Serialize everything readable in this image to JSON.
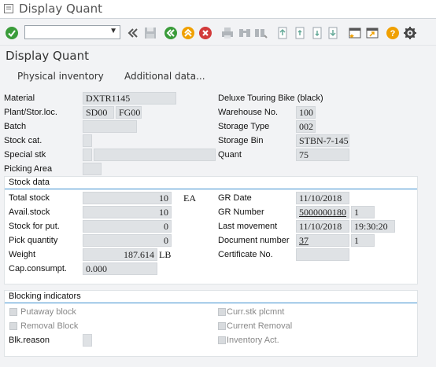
{
  "window": {
    "title": "Display Quant"
  },
  "toolbar": {
    "command_field_value": "",
    "icons": [
      "enter-icon",
      "command-dropdown",
      "collapse-icon",
      "save-icon",
      "back-icon",
      "exit-icon",
      "cancel-icon",
      "print-icon",
      "find-icon",
      "find-next-icon",
      "first-page-icon",
      "previous-page-icon",
      "next-page-icon",
      "last-page-icon",
      "create-session-icon",
      "shortcut-icon",
      "help-icon",
      "settings-icon"
    ]
  },
  "app": {
    "title": "Display Quant",
    "buttons": [
      "Physical inventory",
      "Additional data..."
    ]
  },
  "header": {
    "material_label": "Material",
    "material_value": "DXTR1145",
    "material_desc": "Deluxe Touring Bike (black)",
    "plant_label": "Plant/Stor.loc.",
    "plant_value": "SD00",
    "storloc_value": "FG00",
    "batch_label": "Batch",
    "batch_value": "",
    "stockcat_label": "Stock cat.",
    "stockcat_value": "",
    "specialstk_label": "Special stk",
    "specialstk_value": "",
    "pickingarea_label": "Picking Area",
    "pickingarea_value": "",
    "warehouse_label": "Warehouse No.",
    "warehouse_value": "100",
    "storagetype_label": "Storage Type",
    "storagetype_value": "002",
    "storagebin_label": "Storage Bin",
    "storagebin_value": "STBN-7-145",
    "quant_label": "Quant",
    "quant_value": "75"
  },
  "stock": {
    "group_title": "Stock data",
    "total_label": "Total stock",
    "total_value": "10",
    "total_unit": "EA",
    "avail_label": "Avail.stock",
    "avail_value": "10",
    "forput_label": "Stock for put.",
    "forput_value": "0",
    "pick_label": "Pick quantity",
    "pick_value": "0",
    "weight_label": "Weight",
    "weight_value": "187.614",
    "weight_unit": "LB",
    "capcons_label": "Cap.consumpt.",
    "capcons_value": "0.000",
    "grdate_label": "GR Date",
    "grdate_value": "11/10/2018",
    "grnumber_label": "GR Number",
    "grnumber_value": "5000000180",
    "grnumber_item": "1",
    "lastmove_label": "Last movement",
    "lastmove_date": "11/10/2018",
    "lastmove_time": "19:30:20",
    "docnum_label": "Document number",
    "docnum_value": "37",
    "docnum_item": "1",
    "cert_label": "Certificate No.",
    "cert_value": ""
  },
  "blocking": {
    "group_title": "Blocking indicators",
    "putaway_label": "Putaway block",
    "removal_label": "Removal Block",
    "blkreason_label": "Blk.reason",
    "blkreason_value": "",
    "currstk_label": "Curr.stk plcmnt",
    "currremoval_label": "Current Removal",
    "invact_label": "Inventory Act."
  },
  "colors": {
    "accent_line": "#3c8fd0",
    "enter_green": "#3a9c3a",
    "cancel_red": "#d23a3a",
    "help_orange": "#f0a000"
  }
}
